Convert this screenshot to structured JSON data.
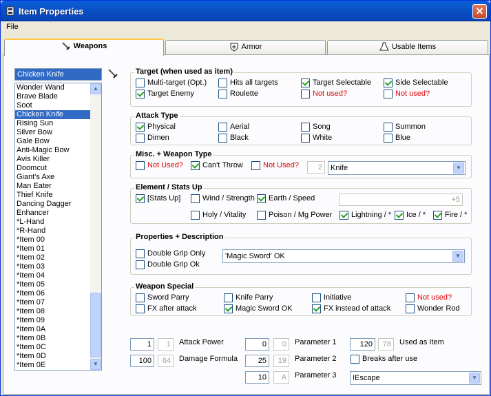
{
  "window": {
    "title": "Item Properties",
    "close": "✕"
  },
  "menu": {
    "file": "File"
  },
  "tabs": [
    {
      "label": "Weapons"
    },
    {
      "label": "Armor"
    },
    {
      "label": "Usable Items"
    }
  ],
  "search": {
    "value": "Chicken Knife"
  },
  "items": [
    "Wonder Wand",
    "Brave Blade",
    "Soot",
    "Chicken Knife",
    "Rising Sun",
    "Silver Bow",
    "Gale Bow",
    "Anti-Magic Bow",
    "Avis Killer",
    "Doomcut",
    "Giant's Axe",
    "Man Eater",
    "Thief Knife",
    "Dancing Dagger",
    "Enhancer",
    "*L-Hand",
    "*R-Hand",
    "*Item 00",
    "*Item 01",
    "*Item 02",
    "*Item 03",
    "*Item 04",
    "*Item 05",
    "*Item 06",
    "*Item 07",
    "*Item 08",
    "*Item 09",
    "*Item 0A",
    "*Item 0B",
    "*Item 0C",
    "*Item 0D",
    "*Item 0E"
  ],
  "selected_item": "Chicken Knife",
  "target": {
    "title": "Target (when used as item)",
    "multi": "Multi-target (Opt.)",
    "hits": "Hits all targets",
    "tsel": "Target Selectable",
    "ssel": "Side Selectable",
    "enemy": "Target Enemy",
    "roulette": "Roulette",
    "nu1": "Not used?",
    "nu2": "Not used?"
  },
  "attack": {
    "title": "Attack Type",
    "physical": "Physical",
    "aerial": "Aerial",
    "song": "Song",
    "summon": "Summon",
    "dimen": "Dimen",
    "black": "Black",
    "white": "White",
    "blue": "Blue"
  },
  "misc": {
    "title": "Misc. + Weapon Type",
    "nu1": "Not Used?",
    "cant": "Can't Throw",
    "nu2": "Not Used?",
    "num": "2",
    "type": "Knife"
  },
  "element": {
    "title": "Element / Stats Up",
    "stats": "[Stats Up]",
    "wind": "Wind / Strength",
    "earth": "Earth / Speed",
    "bonus": "+5",
    "holy": "Holy / Vitality",
    "poison": "Poison / Mg Power",
    "lightning": "Lightning / *",
    "ice": "Ice / *",
    "fire": "Fire / *"
  },
  "props": {
    "title": "Properties + Description",
    "double_only": "Double Grip Only",
    "double_ok": "Double Grip Ok",
    "desc": "'Magic Sword' OK"
  },
  "special": {
    "title": "Weapon Special",
    "sword": "Sword Parry",
    "knife": "Knife Parry",
    "initiative": "Initiative",
    "nu": "Not used?",
    "fx": "FX after attack",
    "magic": "Magic Sword OK",
    "fxi": "FX instead of attack",
    "wonder": "Wonder Rod"
  },
  "stats": {
    "atk": "1",
    "atk_hex": "1",
    "atk_label": "Attack Power",
    "dmg": "100",
    "dmg_hex": "64",
    "dmg_label": "Damage Formula",
    "p1": "0",
    "p1_hex": "0",
    "p1_label": "Parameter 1",
    "p2": "25",
    "p2_hex": "19",
    "p2_label": "Parameter 2",
    "p3": "10",
    "p3_hex": "A",
    "p3_label": "Parameter 3",
    "used": "120",
    "used_hex": "78",
    "used_label": "Used as Item",
    "breaks": "Breaks after use",
    "spell": "!Escape"
  }
}
